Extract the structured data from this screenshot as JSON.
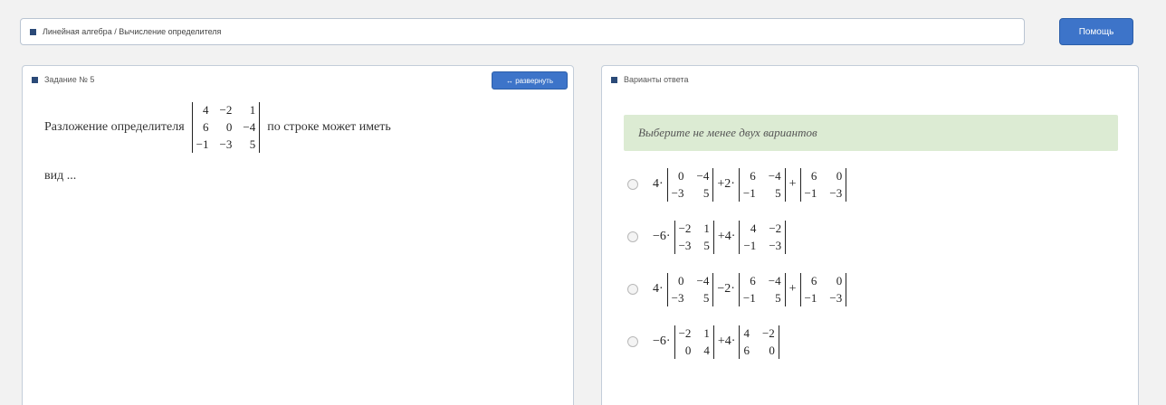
{
  "breadcrumb": "Линейная алгебра / Вычисление определителя",
  "help_button": "Помощь",
  "task": {
    "header": "Задание № 5",
    "expand_button": "↔ развернуть",
    "text_before": "Разложение определителя",
    "matrix": [
      [
        "4",
        "−2",
        "1"
      ],
      [
        "6",
        "0",
        "−4"
      ],
      [
        "−1",
        "−3",
        "5"
      ]
    ],
    "text_after": "по строке может иметь",
    "text_end": "вид ..."
  },
  "answers": {
    "header": "Варианты ответа",
    "hint": "Выберите не менее двух вариантов",
    "options": [
      {
        "c1": "4·",
        "m1": [
          [
            "0",
            "−4"
          ],
          [
            "−3",
            "5"
          ]
        ],
        "op2": "+2·",
        "m2": [
          [
            "6",
            "−4"
          ],
          [
            "−1",
            "5"
          ]
        ],
        "op3": "+",
        "m3": [
          [
            "6",
            "0"
          ],
          [
            "−1",
            "−3"
          ]
        ]
      },
      {
        "c1": "−6·",
        "m1": [
          [
            "−2",
            "1"
          ],
          [
            "−3",
            "5"
          ]
        ],
        "op2": "+4·",
        "m2": [
          [
            "4",
            "−2"
          ],
          [
            "−1",
            "−3"
          ]
        ]
      },
      {
        "c1": "4·",
        "m1": [
          [
            "0",
            "−4"
          ],
          [
            "−3",
            "5"
          ]
        ],
        "op2": "−2·",
        "m2": [
          [
            "6",
            "−4"
          ],
          [
            "−1",
            "5"
          ]
        ],
        "op3": "+",
        "m3": [
          [
            "6",
            "0"
          ],
          [
            "−1",
            "−3"
          ]
        ]
      },
      {
        "c1": "−6·",
        "m1": [
          [
            "−2",
            "1"
          ],
          [
            "0",
            "4"
          ]
        ],
        "op2": "+4·",
        "m2": [
          [
            "4",
            "−2"
          ],
          [
            "6",
            "0"
          ]
        ]
      }
    ]
  }
}
